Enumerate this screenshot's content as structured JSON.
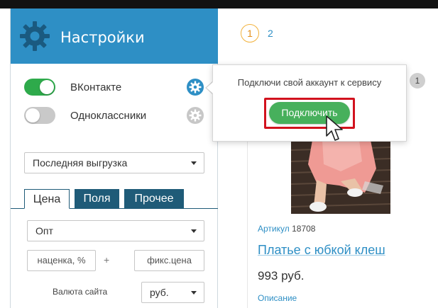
{
  "colors": {
    "header": "#2e8fc5",
    "toggle_on": "#2eaa4b",
    "tab_dark": "#1f5b78",
    "connect": "#47b05c",
    "highlight": "#d2121e",
    "page_active": "#f2b23c"
  },
  "panel": {
    "title": "Настройки",
    "header_icon": "gear-icon",
    "services": [
      {
        "label": "ВКонтакте",
        "enabled": true,
        "icon": "gear-icon"
      },
      {
        "label": "Одноклассники",
        "enabled": false,
        "icon": "gear-icon"
      }
    ],
    "export_select": {
      "value": "Последняя выгрузка"
    },
    "tabs": [
      {
        "label": "Цена",
        "active": true
      },
      {
        "label": "Поля",
        "active": false
      },
      {
        "label": "Прочее",
        "active": false
      }
    ],
    "price_type_select": {
      "value": "Опт"
    },
    "markup_input": {
      "placeholder": "наценка, %"
    },
    "plus_sign": "+",
    "fixed_price_input": {
      "placeholder": "фикс.цена"
    },
    "currency": {
      "label": "Валюта сайта",
      "value": "руб."
    }
  },
  "pagination": {
    "pages": [
      "1",
      "2"
    ],
    "current": "1"
  },
  "popover": {
    "message": "Подключи свой аккаунт к сервису",
    "button_label": "Подключить"
  },
  "product": {
    "badge": "1",
    "article_label": "Артикул",
    "article_value": "18708",
    "title": "Платье с юбкой клеш",
    "price": "993 руб.",
    "description_link": "Описание"
  }
}
